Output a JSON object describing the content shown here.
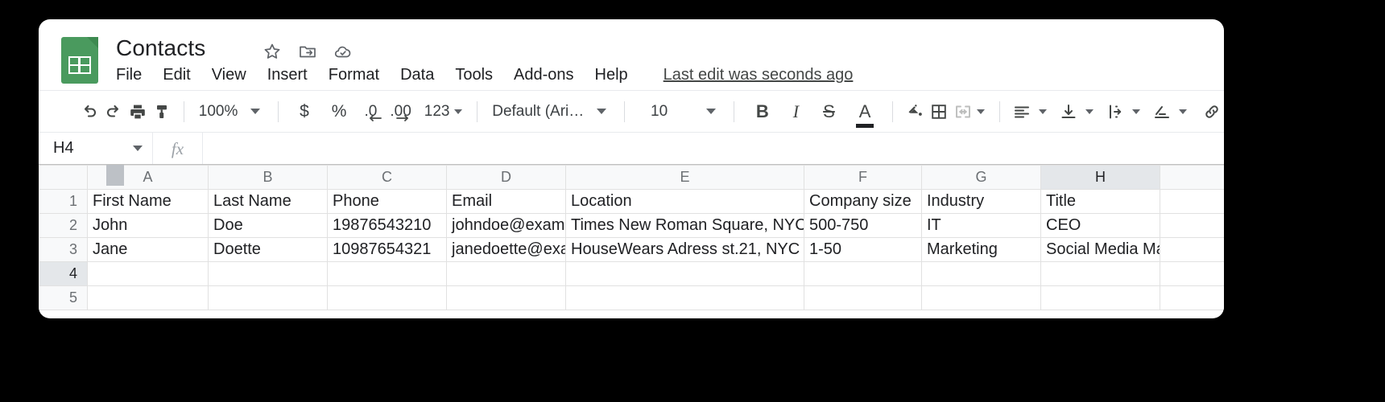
{
  "app": {
    "doc_title": "Contacts",
    "doc_icon": "sheets-icon",
    "title_actions": [
      "star-icon",
      "move-to-folder-icon",
      "cloud-saved-icon"
    ]
  },
  "menubar": {
    "items": [
      {
        "label": "File"
      },
      {
        "label": "Edit"
      },
      {
        "label": "View"
      },
      {
        "label": "Insert"
      },
      {
        "label": "Format"
      },
      {
        "label": "Data"
      },
      {
        "label": "Tools"
      },
      {
        "label": "Add-ons"
      },
      {
        "label": "Help"
      }
    ],
    "last_edit": "Last edit was seconds ago"
  },
  "toolbar": {
    "undo": "undo-icon",
    "redo": "redo-icon",
    "print": "print-icon",
    "paint_format": "paint-format-icon",
    "zoom_value": "100%",
    "currency": "$",
    "percent": "%",
    "decrease_decimal": ".0",
    "increase_decimal": ".00",
    "more_formats": "123",
    "font_name": "Default (Ari…",
    "font_size": "10",
    "bold": "B",
    "italic": "I",
    "strikethrough": "S",
    "text_color": "A",
    "fill_color": "fill-color-icon",
    "borders": "borders-icon",
    "merge_cells": "merge-cells-icon",
    "horizontal_align": "horizontal-align-icon",
    "vertical_align": "vertical-align-icon",
    "text_wrapping": "text-wrapping-icon",
    "text_rotation": "text-rotation-icon",
    "insert_link": "link-icon"
  },
  "formula_bar": {
    "name_box": "H4",
    "fx_label": "fx",
    "formula_value": "",
    "formula_placeholder": ""
  },
  "grid": {
    "selected_cell": "H4",
    "selected_column": "H",
    "selected_row": "4",
    "selection_color": "#1a73e8",
    "columns": [
      "A",
      "B",
      "C",
      "D",
      "E",
      "F",
      "G",
      "H"
    ],
    "row_numbers": [
      "1",
      "2",
      "3",
      "4",
      "5"
    ],
    "rows": [
      [
        "First Name",
        "Last Name",
        "Phone",
        "Email",
        "Location",
        "Company size",
        "Industry",
        "Title"
      ],
      [
        "John",
        "Doe",
        "19876543210",
        "johndoe@example.com",
        "Times New Roman Square, NYC",
        "500-750",
        "IT",
        "CEO"
      ],
      [
        "Jane",
        "Doette",
        "10987654321",
        "janedoette@example.com",
        "HouseWears Adress st.21, NYC",
        "1-50",
        "Marketing",
        "Social Media Manager"
      ],
      [
        "",
        "",
        "",
        "",
        "",
        "",
        "",
        ""
      ],
      [
        "",
        "",
        "",
        "",
        "",
        "",
        "",
        ""
      ]
    ]
  }
}
